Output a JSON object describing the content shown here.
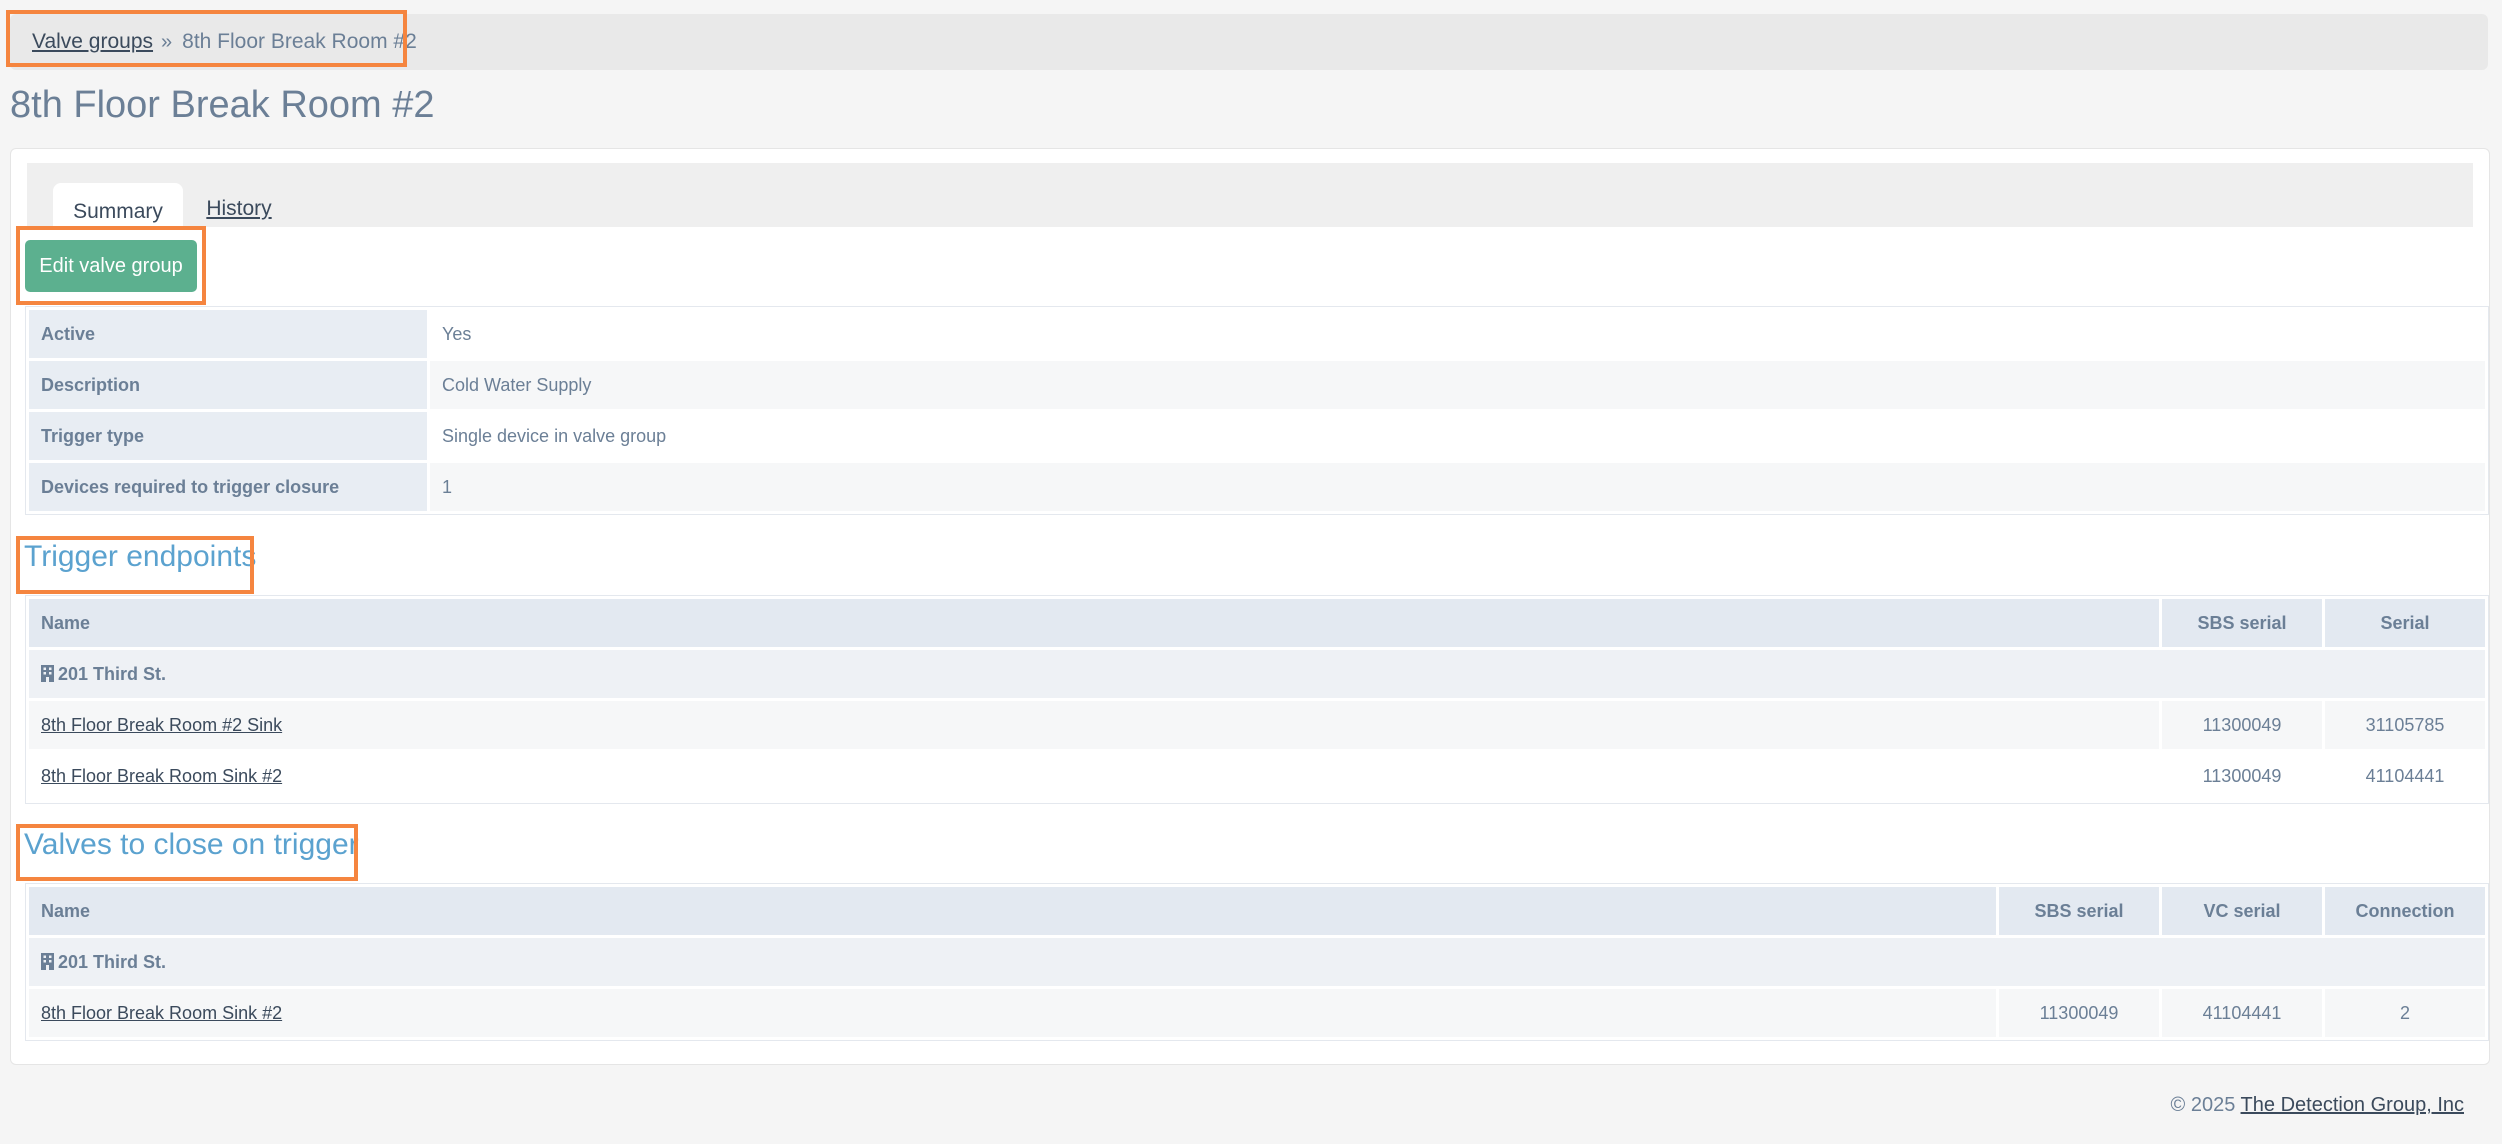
{
  "breadcrumb": {
    "parent": "Valve groups",
    "separator": "»",
    "current": "8th Floor Break Room #2"
  },
  "title": "8th Floor Break Room #2",
  "tabs": {
    "summary": "Summary",
    "history": "History"
  },
  "edit_button": "Edit valve group",
  "details": [
    {
      "label": "Active",
      "value": "Yes"
    },
    {
      "label": "Description",
      "value": "Cold Water Supply"
    },
    {
      "label": "Trigger type",
      "value": "Single device in valve group"
    },
    {
      "label": "Devices required to trigger closure",
      "value": "1"
    }
  ],
  "trigger_section": {
    "heading": "Trigger endpoints",
    "columns": [
      "Name",
      "SBS serial",
      "Serial"
    ],
    "group": "201 Third St.",
    "rows": [
      {
        "name": "8th Floor Break Room #2 Sink",
        "sbs_serial": "11300049",
        "serial": "31105785"
      },
      {
        "name": "8th Floor Break Room Sink #2",
        "sbs_serial": "11300049",
        "serial": "41104441"
      }
    ]
  },
  "valves_section": {
    "heading": "Valves to close on trigger",
    "columns": [
      "Name",
      "SBS serial",
      "VC serial",
      "Connection"
    ],
    "group": "201 Third St.",
    "rows": [
      {
        "name": "8th Floor Break Room Sink #2",
        "sbs_serial": "11300049",
        "vc_serial": "41104441",
        "connection": "2"
      }
    ]
  },
  "footer": {
    "copyright": "© 2025",
    "company": "The Detection Group, Inc"
  },
  "colors": {
    "accent_button": "#5cb08f",
    "heading_blue": "#5ba2cf",
    "highlight": "#f5853f"
  },
  "icons": {
    "building": "building-icon"
  }
}
